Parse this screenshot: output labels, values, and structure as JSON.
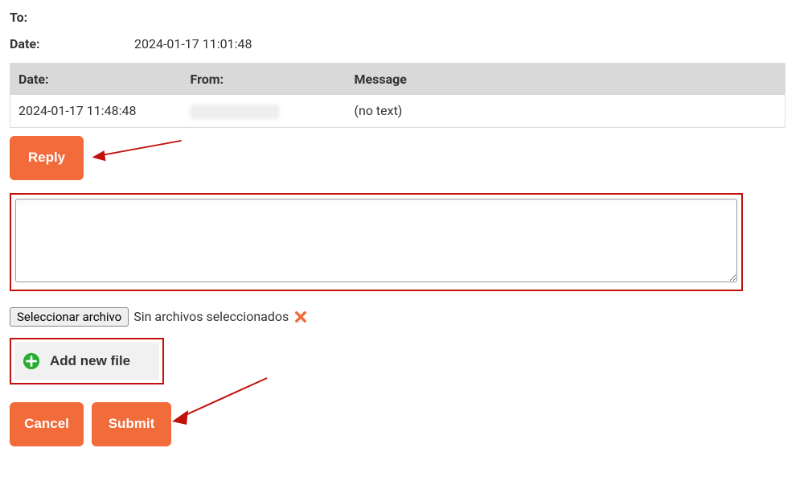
{
  "fields": {
    "to_label": "To:",
    "to_value": "",
    "date_label": "Date:",
    "date_value": "2024-01-17 11:01:48"
  },
  "table": {
    "headers": {
      "date": "Date:",
      "from": "From:",
      "message": "Message"
    },
    "rows": [
      {
        "date": "2024-01-17 11:48:48",
        "from": "",
        "message": "(no text)"
      }
    ]
  },
  "buttons": {
    "reply": "Reply",
    "cancel": "Cancel",
    "submit": "Submit",
    "add_new_file": "Add new file",
    "file_select": "Seleccionar archivo"
  },
  "file": {
    "status": "Sin archivos seleccionados"
  },
  "textarea": {
    "value": "",
    "placeholder": ""
  },
  "colors": {
    "accent": "#f26b3a",
    "annotation": "#c0110a",
    "plus_green": "#27ae33"
  }
}
